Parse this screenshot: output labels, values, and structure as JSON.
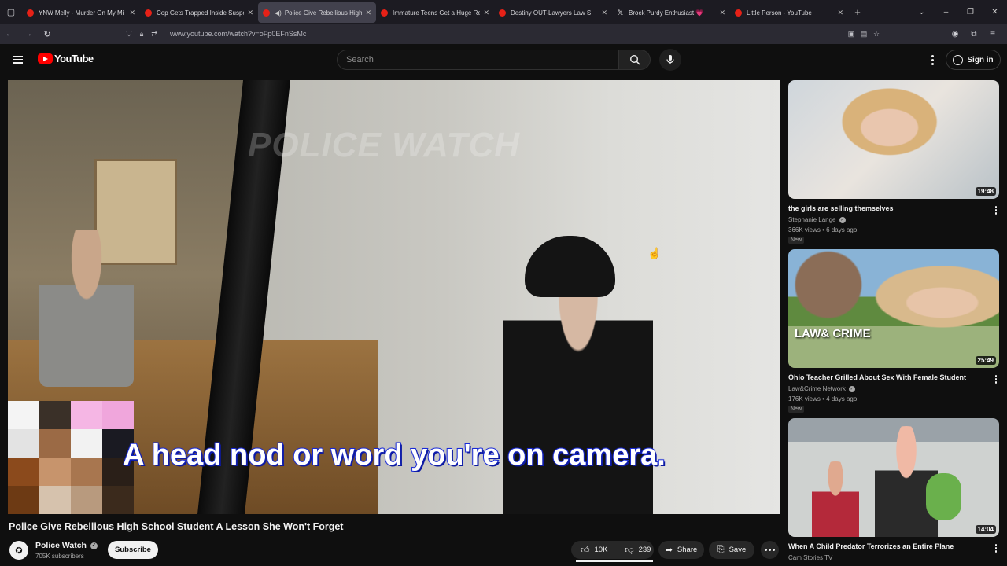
{
  "browser": {
    "tabs": [
      {
        "title": "YNW Melly - Murder On My Mi",
        "favicon": "youtube-favicon",
        "active": false
      },
      {
        "title": "Cop Gets Trapped Inside Suspe",
        "favicon": "youtube-favicon",
        "active": false
      },
      {
        "title": "Police Give Rebellious High",
        "favicon": "youtube-favicon",
        "active": true,
        "audio": true
      },
      {
        "title": "Immature Teens Get a Huge Re",
        "favicon": "youtube-favicon",
        "active": false
      },
      {
        "title": "Destiny OUT-Lawyers Law S",
        "favicon": "youtube-favicon",
        "active": false
      },
      {
        "title": "Brock Purdy Enthusiast 💗",
        "favicon": "x-favicon",
        "active": false
      },
      {
        "title": "Little Person - YouTube",
        "favicon": "youtube-favicon",
        "active": false
      }
    ],
    "url": "www.youtube.com/watch?v=oFp0EFnSsMc"
  },
  "masthead": {
    "logo_text": "YouTube",
    "search_placeholder": "Search",
    "signin_label": "Sign in"
  },
  "player": {
    "watermark": "POLICE WATCH",
    "caption": "A head nod or word you're on camera."
  },
  "video": {
    "title": "Police Give Rebellious High School Student A Lesson She Won't Forget",
    "channel": "Police Watch",
    "subscribers": "705K subscribers",
    "subscribe_label": "Subscribe",
    "likes": "10K",
    "dislikes": "239",
    "share_label": "Share",
    "save_label": "Save"
  },
  "recommendations": [
    {
      "title": "the girls are selling themselves",
      "channel": "Stephanie Lange",
      "verified": true,
      "meta": "366K views • 6 days ago",
      "badge": "New",
      "duration": "19:48"
    },
    {
      "title": "Ohio Teacher Grilled About Sex With Female Student",
      "channel": "Law&Crime Network",
      "verified": true,
      "meta": "176K views • 4 days ago",
      "badge": "New",
      "duration": "25:49",
      "thumb_text": "LAW& CRIME"
    },
    {
      "title": "When A Child Predator Terrorizes an Entire Plane",
      "channel": "Cam Stories TV",
      "verified": false,
      "meta": "",
      "badge": "",
      "duration": "14:04"
    }
  ]
}
